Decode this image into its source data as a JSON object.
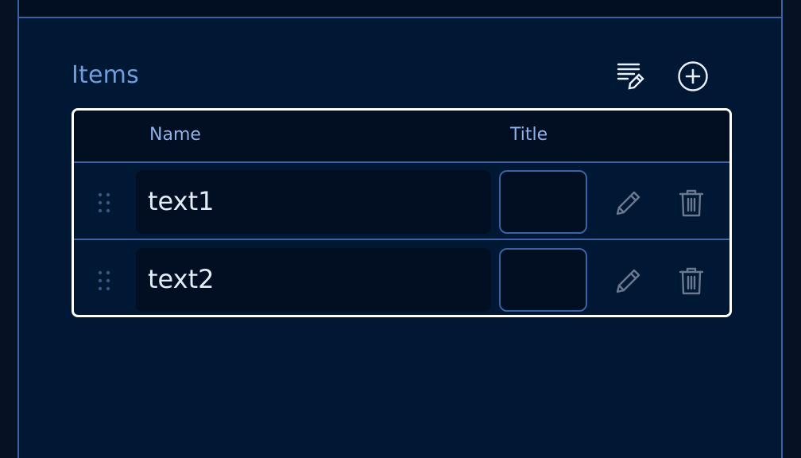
{
  "section": {
    "title": "Items",
    "bulk_edit_icon": "list-edit-icon",
    "add_icon": "plus-circle-icon"
  },
  "table": {
    "columns": {
      "name": "Name",
      "title": "Title"
    },
    "rows": [
      {
        "name": "text1",
        "title": ""
      },
      {
        "name": "text2",
        "title": ""
      }
    ],
    "row_icons": {
      "drag": "drag-handle-icon",
      "edit": "pencil-icon",
      "delete": "trash-icon"
    }
  },
  "colors": {
    "background": "#001833",
    "header_bg": "#020f22",
    "accent": "#6f9ee0",
    "border": "#3a63a6",
    "table_outline": "#ffffff"
  }
}
